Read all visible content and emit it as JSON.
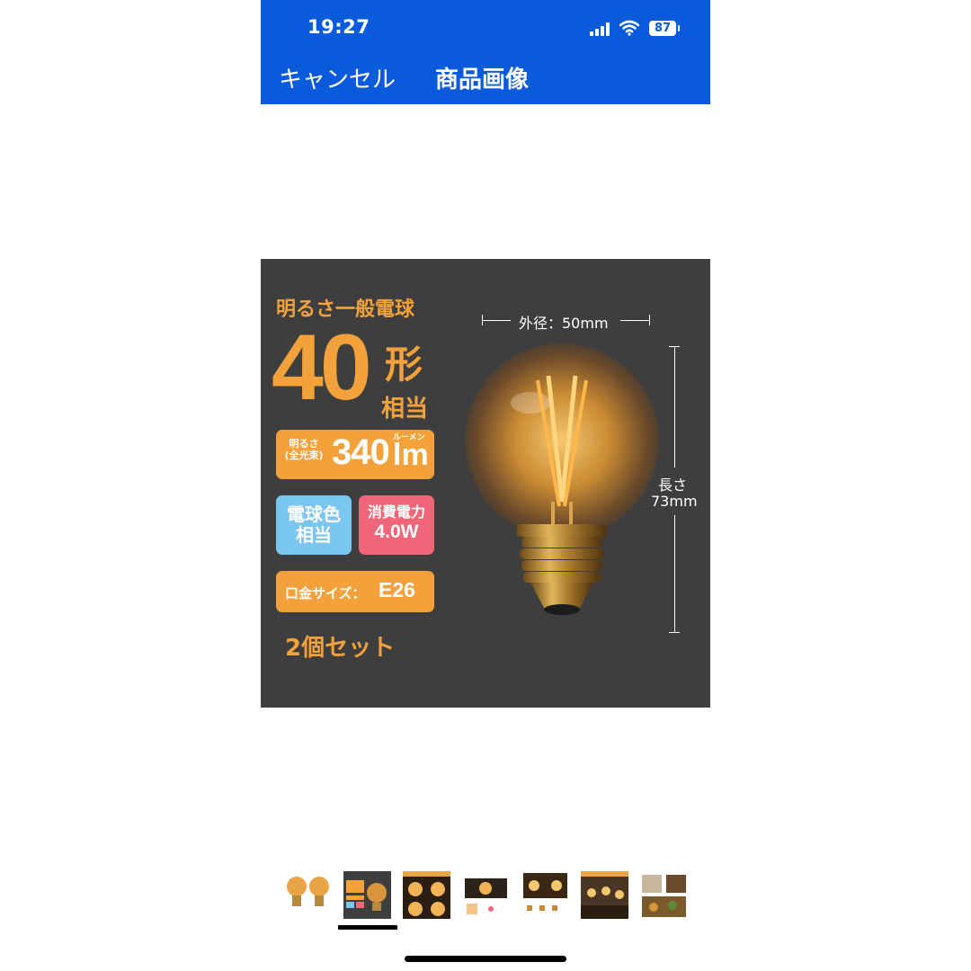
{
  "status_bar": {
    "time": "19:27",
    "battery": "87"
  },
  "nav": {
    "cancel_label": "キャンセル",
    "title": "商品画像"
  },
  "product": {
    "headline": "明るさ一般電球",
    "wattage_equiv_number": "40",
    "wattage_equiv_shape": "形",
    "wattage_equiv_suffix": "相当",
    "lumen_label_line1": "明るさ",
    "lumen_label_line2": "(全光束)",
    "lumen_value": "340",
    "lumen_unit_ruby": "ルーメン",
    "lumen_unit": "lm",
    "color_line1": "電球色",
    "color_line2": "相当",
    "power_label": "消費電力",
    "power_value": "4.0W",
    "base_label": "口金サイズ：",
    "base_value": "E26",
    "set_text": "2個セット",
    "diameter_label": "外径：50mm",
    "length_label": "長さ",
    "length_value": "73mm"
  },
  "thumbnails": {
    "count": 7,
    "selected_index": 1
  },
  "colors": {
    "header_blue": "#0a5bdc",
    "accent_orange": "#f3a13a",
    "blue_badge": "#7bc6f0",
    "pink_badge": "#ee6678",
    "product_bg": "#3e3e3f"
  }
}
